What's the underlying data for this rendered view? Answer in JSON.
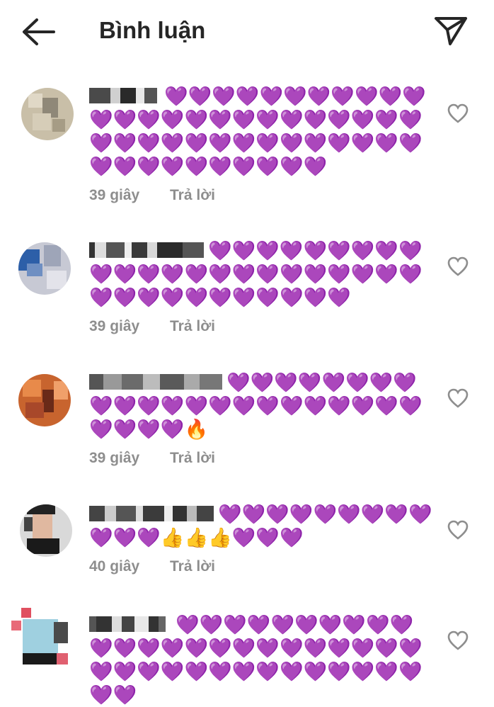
{
  "header": {
    "title": "Bình luận",
    "back_icon": "arrow-left-icon",
    "send_icon": "paper-plane-icon"
  },
  "colors": {
    "heart": "#a330e6",
    "meta_text": "#8e8e8e",
    "primary_text": "#262626"
  },
  "comments": [
    {
      "text": "💜💜💜💜💜💜💜💜💜💜💜💜💜💜💜💜💜💜💜💜💜💜💜💜💜💜💜💜💜💜💜💜💜💜💜💜💜💜💜💜💜💜💜💜💜💜💜💜💜",
      "time": "39 giây",
      "reply": "Trả lời"
    },
    {
      "text": "💜💜💜💜💜💜💜💜💜💜💜💜💜💜💜💜💜💜💜💜💜💜💜💜💜💜💜💜💜💜💜💜💜💜",
      "time": "39 giây",
      "reply": "Trả lời"
    },
    {
      "text": "💜💜💜💜💜💜💜💜💜💜💜💜💜💜💜💜💜💜💜💜💜💜💜💜💜💜🔥",
      "time": "39 giây",
      "reply": "Trả lời"
    },
    {
      "text": "💜💜💜💜💜💜💜💜💜💜💜💜👍👍👍💜💜💜",
      "time": "40 giây",
      "reply": "Trả lời"
    },
    {
      "text": "💜💜💜💜💜💜💜💜💜💜💜💜💜💜💜💜💜💜💜💜💜💜💜💜💜💜💜💜💜💜💜💜💜💜💜💜💜💜💜💜",
      "time": "",
      "reply": ""
    }
  ]
}
